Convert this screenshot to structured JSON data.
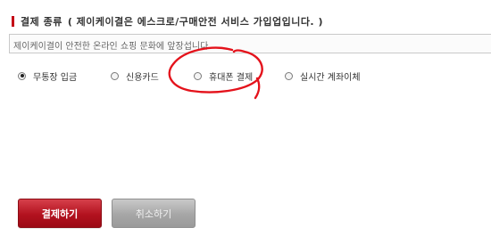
{
  "section": {
    "title": "결제 종류",
    "subtitle": "( 제이케이결은 에스크로/구매안전 서비스 가입업입니다. )",
    "info": "제이케이결이 안전한 온라인 쇼핑 문화에 앞장섭니다"
  },
  "payment_options": [
    {
      "label": "무통장 입금",
      "checked": true
    },
    {
      "label": "신용카드",
      "checked": false
    },
    {
      "label": "휴대폰 결제",
      "checked": false
    },
    {
      "label": "실시간 계좌이체",
      "checked": false
    }
  ],
  "buttons": {
    "pay": "결제하기",
    "cancel": "취소하기"
  },
  "colors": {
    "accent": "#c40016",
    "annotation": "#e4121b"
  }
}
